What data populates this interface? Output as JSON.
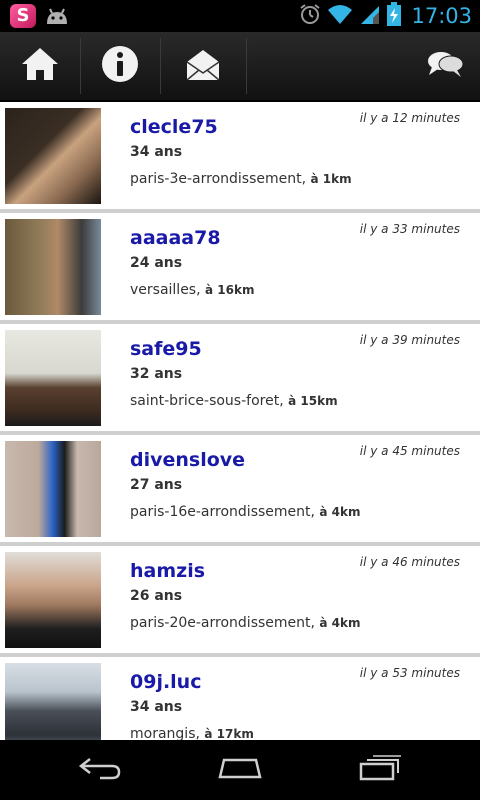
{
  "status": {
    "time": "17:03",
    "icons": [
      "s-app-icon",
      "android-debug-icon",
      "alarm-icon",
      "wifi-icon",
      "signal-icon",
      "battery-charging-icon"
    ]
  },
  "actionbar": {
    "icons": [
      "home-icon",
      "info-icon",
      "mail-icon",
      "chat-icon"
    ]
  },
  "users": [
    {
      "name": "clecle75",
      "age": "34 ans",
      "city": "paris-3e-arrondissement,",
      "distance": "à 1km",
      "time": "il y a 12 minutes",
      "avatar_colors": [
        "#3a2e24",
        "#c9a27f"
      ]
    },
    {
      "name": "aaaaa78",
      "age": "24 ans",
      "city": "versailles,",
      "distance": "à 16km",
      "time": "il y a 33 minutes",
      "avatar_colors": [
        "#6b5a3e",
        "#b08968"
      ]
    },
    {
      "name": "safe95",
      "age": "32 ans",
      "city": "saint-brice-sous-foret,",
      "distance": "à 15km",
      "time": "il y a 39 minutes",
      "avatar_colors": [
        "#d8d8d0",
        "#3b2a1f"
      ]
    },
    {
      "name": "divenslove",
      "age": "27 ans",
      "city": "paris-16e-arrondissement,",
      "distance": "à 4km",
      "time": "il y a 45 minutes",
      "avatar_colors": [
        "#c8b8ae",
        "#2a62c4"
      ]
    },
    {
      "name": "hamzis",
      "age": "26 ans",
      "city": "paris-20e-arrondissement,",
      "distance": "à 4km",
      "time": "il y a 46 minutes",
      "avatar_colors": [
        "#e0ddd8",
        "#1e1e1e"
      ]
    },
    {
      "name": "09j.luc",
      "age": "34 ans",
      "city": "morangis,",
      "distance": "à 17km",
      "time": "il y a 53 minutes",
      "avatar_colors": [
        "#b9c3cc",
        "#2d3138"
      ]
    }
  ],
  "nav": {
    "icons": [
      "back-icon",
      "home-nav-icon",
      "recent-apps-icon"
    ]
  }
}
